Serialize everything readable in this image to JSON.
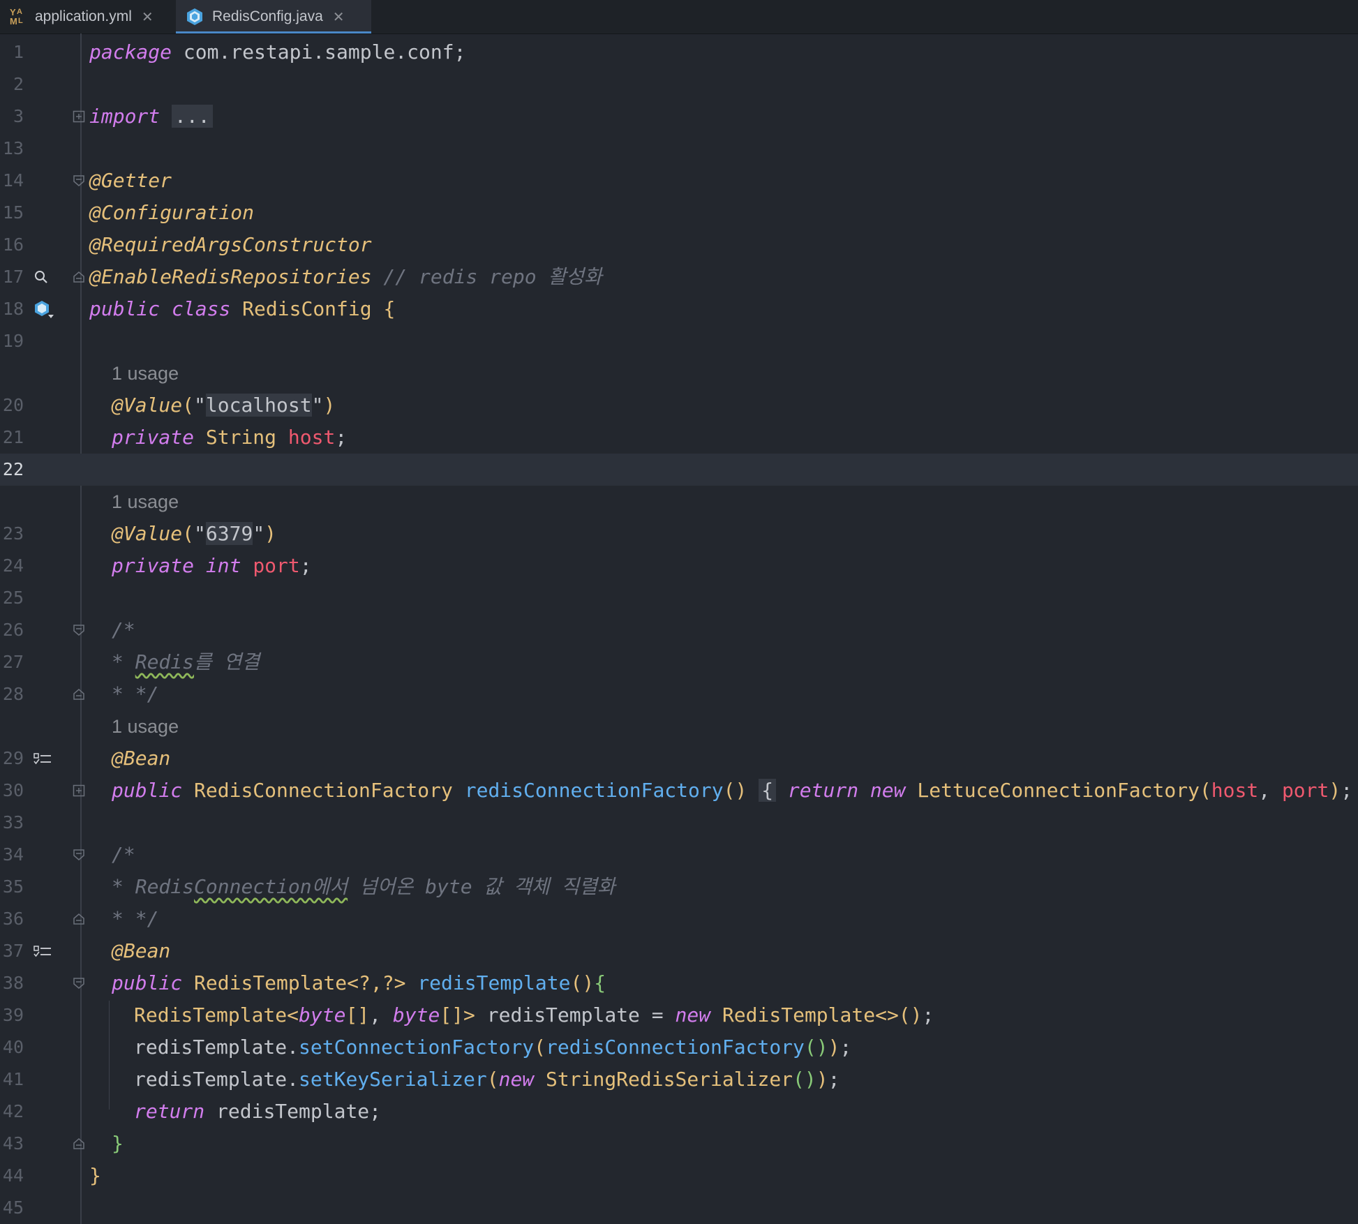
{
  "tabs": [
    {
      "label": "application.yml",
      "active": false,
      "icon": "yaml-icon"
    },
    {
      "label": "RedisConfig.java",
      "active": true,
      "icon": "java-class-icon"
    }
  ],
  "hint_label": "1 usage",
  "lines": {
    "l1": "1",
    "l2": "2",
    "l3": "3",
    "l13": "13",
    "l14": "14",
    "l15": "15",
    "l16": "16",
    "l17": "17",
    "l18": "18",
    "l19": "19",
    "l20": "20",
    "l21": "21",
    "l22": "22",
    "l23": "23",
    "l24": "24",
    "l25": "25",
    "l26": "26",
    "l27": "27",
    "l28": "28",
    "l29": "29",
    "l30": "30",
    "l33": "33",
    "l34": "34",
    "l35": "35",
    "l36": "36",
    "l37": "37",
    "l38": "38",
    "l39": "39",
    "l40": "40",
    "l41": "41",
    "l42": "42",
    "l43": "43",
    "l44": "44",
    "l45": "45"
  },
  "code": {
    "package_kw": "package",
    "package_name": " com.restapi.sample.conf;",
    "import_kw": "import",
    "import_fold": "...",
    "ann_getter": "@Getter",
    "ann_configuration": "@Configuration",
    "ann_required": "@RequiredArgsConstructor",
    "ann_enable": "@EnableRedisRepositories",
    "comment_enable": " // redis repo 활성화",
    "public_kw": "public",
    "class_kw": "class",
    "class_name": "RedisConfig",
    "open_brace": " {",
    "value_ann": "@Value",
    "host_value": "localhost",
    "port_value": "6379",
    "private_kw": "private",
    "string_type": " String ",
    "host_field": "host",
    "int_kw": "int",
    "port_field": "port",
    "comment_open": "/*",
    "comment_redis_prefix": "* ",
    "comment_redis_word": "Redis",
    "comment_redis_rest": "를 연결",
    "comment_close": "* */",
    "bean_ann": "@Bean",
    "factory_type": " RedisConnectionFactory ",
    "factory_method": "redisConnectionFactory",
    "return_kw": "return",
    "new_kw": "new",
    "lettuce_class": " LettuceConnectionFactory",
    "comment2_prefix": "* Redis",
    "comment2_word": "Connection에서",
    "comment2_rest": " 넘어온 byte 값 객체 직렬화",
    "template_type": " RedisTemplate",
    "wild_generic": "<?,?>",
    "template_method": "redisTemplate",
    "template_class": "RedisTemplate",
    "byte_kw": "byte",
    "template_var": "redisTemplate",
    "set_factory": "setConnectionFactory",
    "set_key": "setKeySerializer",
    "serializer_class": " StringRedisSerializer",
    "return_var": " redisTemplate;"
  }
}
